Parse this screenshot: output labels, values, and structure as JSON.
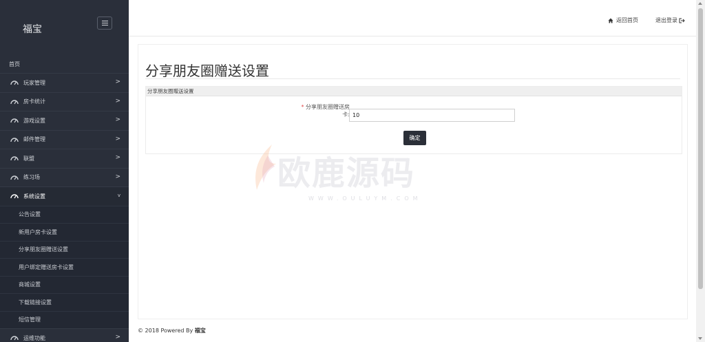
{
  "app": {
    "brand": "福宝"
  },
  "sidebar": {
    "home_label": "首页",
    "menu": [
      {
        "label": "玩家管理",
        "icon": "dashboard-icon",
        "chevron": ">"
      },
      {
        "label": "房卡统计",
        "icon": "dashboard-icon",
        "chevron": ">"
      },
      {
        "label": "游戏设置",
        "icon": "dashboard-icon",
        "chevron": ">"
      },
      {
        "label": "邮件管理",
        "icon": "dashboard-icon",
        "chevron": ">"
      },
      {
        "label": "联盟",
        "icon": "dashboard-icon",
        "chevron": ">"
      },
      {
        "label": "练习场",
        "icon": "dashboard-icon",
        "chevron": ">"
      },
      {
        "label": "系统设置",
        "icon": "dashboard-icon",
        "chevron": "v",
        "active": true
      }
    ],
    "submenu": [
      {
        "label": "公告设置"
      },
      {
        "label": "新用户房卡设置"
      },
      {
        "label": "分享朋友圈赠送设置"
      },
      {
        "label": "用户绑定赠送房卡设置"
      },
      {
        "label": "商城设置"
      },
      {
        "label": "下载链接设置"
      },
      {
        "label": "短信管理"
      }
    ],
    "last_item": {
      "label": "运维功能",
      "chevron": ">"
    }
  },
  "topbar": {
    "home_link": "返回首页",
    "logout_link": "退出登录"
  },
  "main": {
    "page_title": "分享朋友圈赠送设置",
    "section_title": "分享朋友圈赠送设置",
    "field": {
      "required_mark": "*",
      "label_line1": "分享朋友圈赠送房",
      "label_line2": "卡:",
      "value": "10"
    },
    "confirm_label": "确定"
  },
  "watermark": {
    "text": "欧鹿源码",
    "url": "WWW.OULUYM.COM"
  },
  "footer": {
    "prefix": "© 2018 Powered By ",
    "brand": "福宝"
  },
  "colors": {
    "sidebar_bg": "#2a2f3a",
    "button_bg": "#2b2f38",
    "required": "#e04848"
  }
}
